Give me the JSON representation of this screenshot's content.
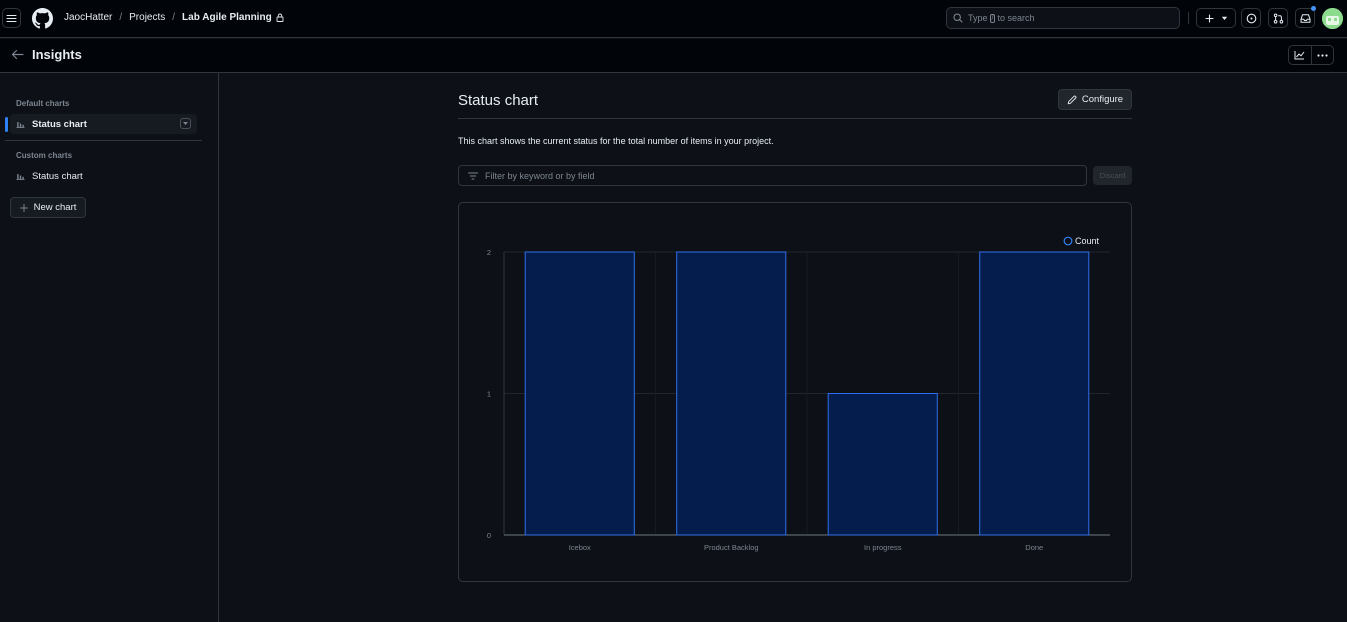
{
  "header": {
    "breadcrumbs": [
      "JaocHatter",
      "Projects",
      "Lab Agile Planning"
    ],
    "search": {
      "prefix": "Type",
      "key": "/",
      "suffix": "to search"
    }
  },
  "page": {
    "title": "Insights"
  },
  "sidebar": {
    "default_heading": "Default charts",
    "default_items": [
      {
        "label": "Status chart",
        "active": true
      }
    ],
    "custom_heading": "Custom charts",
    "custom_items": [
      {
        "label": "Status chart",
        "active": false
      }
    ],
    "new_chart_label": "New chart"
  },
  "main": {
    "title": "Status chart",
    "configure_label": "Configure",
    "description": "This chart shows the current status for the total number of items in your project.",
    "filter_placeholder": "Filter by keyword or by field",
    "discard_label": "Discard"
  },
  "colors": {
    "bar_fill": "#051d4d",
    "bar_stroke": "#2f6feb",
    "accent": "#2f81f7"
  },
  "chart_data": {
    "type": "bar",
    "categories": [
      "Icebox",
      "Product Backlog",
      "In progress",
      "Done"
    ],
    "series": [
      {
        "name": "Count",
        "values": [
          2,
          2,
          1,
          2
        ]
      }
    ],
    "ylim": [
      0,
      2
    ],
    "yticks": [
      0,
      1,
      2
    ],
    "legend": "top-right",
    "grid": true
  }
}
